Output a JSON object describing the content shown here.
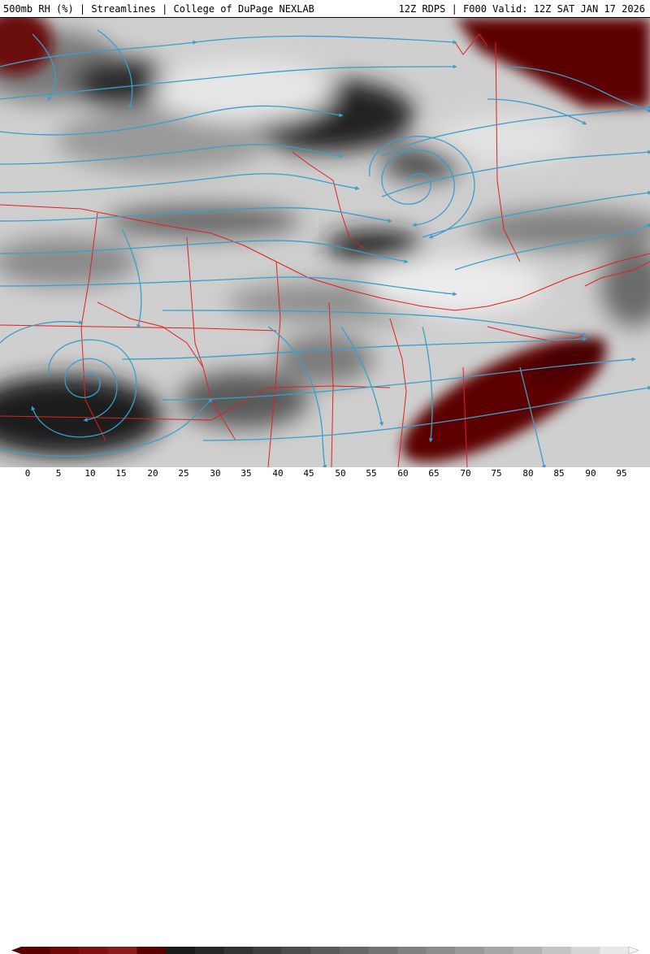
{
  "header": {
    "left_title": "500mb RH (%) | Streamlines | College of DuPage NEXLAB",
    "right_title": "12Z RDPS | F000 Valid: 12Z SAT JAN 17 2026"
  },
  "map": {
    "field": "500mb relative humidity",
    "overlay": "streamlines",
    "streamline_color": "#3a9fc8",
    "boundary_color": "#e02020",
    "dry_color": "#6a0000",
    "moist_color": "#f4f4f4"
  },
  "legend": {
    "ticks": [
      "0",
      "5",
      "10",
      "15",
      "20",
      "25",
      "30",
      "35",
      "40",
      "45",
      "50",
      "55",
      "60",
      "65",
      "70",
      "75",
      "80",
      "85",
      "90",
      "95"
    ],
    "colors": [
      "#5a0000",
      "#6e0808",
      "#801010",
      "#8c1a1a",
      "#5a0000",
      "#1a1a1a",
      "#262626",
      "#333333",
      "#3f3f3f",
      "#4c4c4c",
      "#595959",
      "#666666",
      "#737373",
      "#808080",
      "#8c8c8c",
      "#999999",
      "#a6a6a6",
      "#b3b3b3",
      "#c4c4c4",
      "#d6d6d6",
      "#e8e8e8"
    ]
  }
}
